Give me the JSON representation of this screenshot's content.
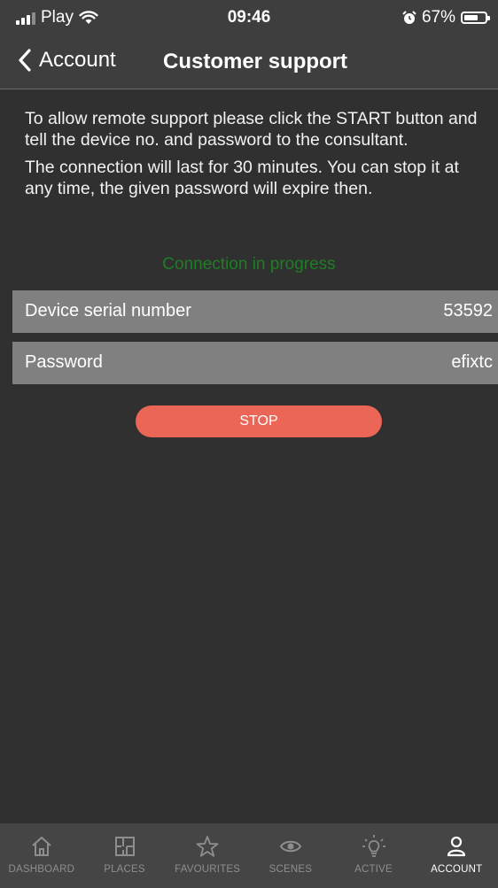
{
  "status_bar": {
    "carrier": "Play",
    "time": "09:46",
    "battery": "67%",
    "battery_level": 0.67
  },
  "nav": {
    "back_label": "Account",
    "title": "Customer support"
  },
  "info": {
    "para1": "To allow remote support please click the START button and tell the device no. and password to the consultant.",
    "para2": "The connection will last for 30 minutes. You can stop it at any time, the given password will expire then."
  },
  "connection_status": "Connection in progress",
  "status_color": "#1f7d26",
  "fields": {
    "serial_label": "Device serial number",
    "serial_value": "53592",
    "password_label": "Password",
    "password_value": "efixtc"
  },
  "stop_button": {
    "label": "STOP",
    "color": "#ec6658"
  },
  "tabs": [
    {
      "label": "DASHBOARD",
      "icon": "home-icon",
      "active": false
    },
    {
      "label": "PLACES",
      "icon": "floorplan-icon",
      "active": false
    },
    {
      "label": "FAVOURITES",
      "icon": "star-icon",
      "active": false
    },
    {
      "label": "SCENES",
      "icon": "eye-icon",
      "active": false
    },
    {
      "label": "ACTIVE",
      "icon": "bulb-icon",
      "active": false
    },
    {
      "label": "ACCOUNT",
      "icon": "person-icon",
      "active": true
    }
  ]
}
